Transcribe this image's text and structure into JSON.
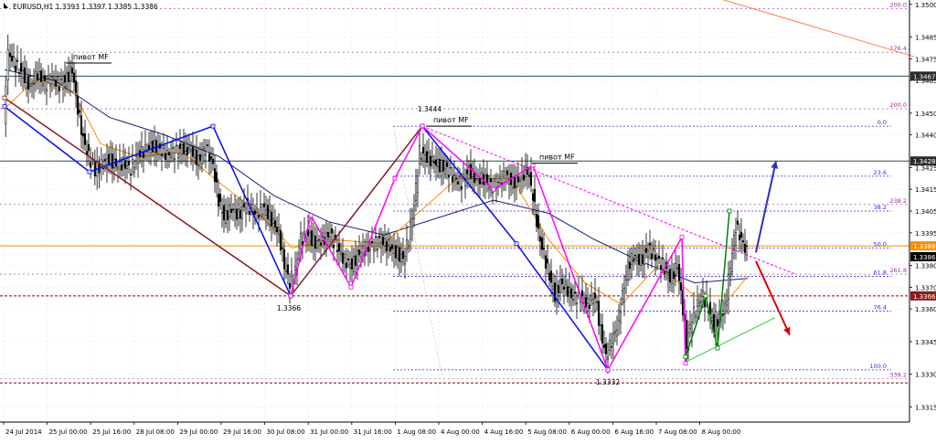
{
  "header": {
    "symbol_text": "EURUSD,H1  1.3393 1.3397 1.3385 1.3386"
  },
  "chart_data": {
    "type": "candlestick",
    "symbol": "EURUSD",
    "timeframe": "H1",
    "ohlc_header": {
      "open": 1.3393,
      "high": 1.3397,
      "low": 1.3385,
      "close": 1.3386
    },
    "ylim": [
      1.3308,
      1.3502
    ],
    "y_ticks": [
      1.35,
      1.3485,
      1.3475,
      1.3465,
      1.345,
      1.344,
      1.3425,
      1.3415,
      1.3405,
      1.3395,
      1.338,
      1.337,
      1.336,
      1.3345,
      1.333,
      1.3315
    ],
    "x_ticks": [
      "24 Jul 2014",
      "25 Jul 00:00",
      "25 Jul 16:00",
      "28 Jul 08:00",
      "29 Jul 00:00",
      "29 Jul 16:00",
      "30 Jul 08:00",
      "31 Jul 00:00",
      "31 Jul 16:00",
      "1 Aug 08:00",
      "4 Aug 00:00",
      "4 Aug 16:00",
      "5 Aug 08:00",
      "6 Aug 00:00",
      "6 Aug 16:00",
      "7 Aug 08:00",
      "8 Aug 00:00"
    ],
    "axis_badges": [
      {
        "value": "1.3467",
        "bg": "#2b2b2b",
        "fg": "#ffffff"
      },
      {
        "value": "1.3428",
        "bg": "#2b2b2b",
        "fg": "#ffffff"
      },
      {
        "value": "1.3388",
        "bg": "#ff8c00",
        "fg": "#ffffff"
      },
      {
        "value": "1.3386",
        "bg": "#000000",
        "fg": "#ffffff"
      },
      {
        "value": "1.3366",
        "bg": "#8b1a1a",
        "fg": "#ffffff"
      }
    ],
    "horizontal_lines": [
      {
        "price": 1.3467,
        "color": "#2f4f4f",
        "style": "solid"
      },
      {
        "price": 1.3428,
        "color": "#2f4f4f",
        "style": "solid"
      },
      {
        "price": 1.3389,
        "color": "#ff8c00",
        "style": "solid"
      },
      {
        "price": 1.3366,
        "color": "#8b0000",
        "style": "dashed"
      },
      {
        "price": 1.3326,
        "color": "#8b0000",
        "style": "dashed"
      }
    ],
    "fibo_levels": [
      {
        "label": "0.0",
        "price": 1.3444
      },
      {
        "label": "23.6",
        "price": 1.3421
      },
      {
        "label": "38.2",
        "price": 1.3405
      },
      {
        "label": "50.0",
        "price": 1.3388
      },
      {
        "label": "61.8",
        "price": 1.3375
      },
      {
        "label": "76.4",
        "price": 1.3359
      },
      {
        "label": "100.0",
        "price": 1.3332
      }
    ],
    "fibo_ext_levels": [
      {
        "label": "200.0",
        "price": 1.3498
      },
      {
        "label": "176.4",
        "price": 1.3478
      },
      {
        "label": "200.0",
        "price": 1.3452
      },
      {
        "label": "238.2",
        "price": 1.3408
      },
      {
        "label": "261.8",
        "price": 1.3376
      },
      {
        "label": "338.2",
        "price": 1.3328
      }
    ],
    "annotations": [
      {
        "text": "пивот MF",
        "x": 80,
        "price": 1.3473
      },
      {
        "text": "пивот MF",
        "x": 474,
        "price": 1.3444
      },
      {
        "text": "пивот MF",
        "x": 590,
        "price": 1.3427
      }
    ],
    "price_labels": [
      {
        "text": "1.3444",
        "x": 470,
        "price": 1.3444
      },
      {
        "text": "1.3366",
        "x": 316,
        "price": 1.3366
      },
      {
        "text": "1.3332",
        "x": 665,
        "price": 1.3332
      }
    ],
    "zigzag": [
      {
        "x": 5,
        "price": 1.3453
      },
      {
        "x": 98,
        "price": 1.3423
      },
      {
        "x": 233,
        "price": 1.3444
      },
      {
        "x": 318,
        "price": 1.3366
      },
      {
        "x": 462,
        "price": 1.3444
      },
      {
        "x": 565,
        "price": 1.339
      },
      {
        "x": 665,
        "price": 1.3332
      }
    ],
    "close_path": [
      {
        "x": 5,
        "price": 1.3448
      },
      {
        "x": 10,
        "price": 1.3478
      },
      {
        "x": 18,
        "price": 1.3472
      },
      {
        "x": 26,
        "price": 1.3468
      },
      {
        "x": 34,
        "price": 1.3462
      },
      {
        "x": 42,
        "price": 1.3468
      },
      {
        "x": 50,
        "price": 1.3463
      },
      {
        "x": 58,
        "price": 1.3466
      },
      {
        "x": 66,
        "price": 1.3463
      },
      {
        "x": 74,
        "price": 1.3466
      },
      {
        "x": 80,
        "price": 1.347
      },
      {
        "x": 86,
        "price": 1.3452
      },
      {
        "x": 92,
        "price": 1.3438
      },
      {
        "x": 98,
        "price": 1.343
      },
      {
        "x": 105,
        "price": 1.3424
      },
      {
        "x": 112,
        "price": 1.3426
      },
      {
        "x": 120,
        "price": 1.3429
      },
      {
        "x": 128,
        "price": 1.3426
      },
      {
        "x": 136,
        "price": 1.3427
      },
      {
        "x": 144,
        "price": 1.3424
      },
      {
        "x": 152,
        "price": 1.3431
      },
      {
        "x": 160,
        "price": 1.3433
      },
      {
        "x": 168,
        "price": 1.3435
      },
      {
        "x": 176,
        "price": 1.3433
      },
      {
        "x": 184,
        "price": 1.3431
      },
      {
        "x": 192,
        "price": 1.3432
      },
      {
        "x": 200,
        "price": 1.3434
      },
      {
        "x": 210,
        "price": 1.3433
      },
      {
        "x": 218,
        "price": 1.3428
      },
      {
        "x": 226,
        "price": 1.3434
      },
      {
        "x": 234,
        "price": 1.3426
      },
      {
        "x": 240,
        "price": 1.341
      },
      {
        "x": 246,
        "price": 1.3402
      },
      {
        "x": 254,
        "price": 1.3406
      },
      {
        "x": 262,
        "price": 1.3403
      },
      {
        "x": 270,
        "price": 1.3408
      },
      {
        "x": 280,
        "price": 1.3404
      },
      {
        "x": 290,
        "price": 1.3406
      },
      {
        "x": 298,
        "price": 1.3401
      },
      {
        "x": 306,
        "price": 1.3395
      },
      {
        "x": 312,
        "price": 1.338
      },
      {
        "x": 318,
        "price": 1.3372
      },
      {
        "x": 324,
        "price": 1.3378
      },
      {
        "x": 330,
        "price": 1.3392
      },
      {
        "x": 338,
        "price": 1.3394
      },
      {
        "x": 346,
        "price": 1.339
      },
      {
        "x": 354,
        "price": 1.3392
      },
      {
        "x": 362,
        "price": 1.3394
      },
      {
        "x": 370,
        "price": 1.3388
      },
      {
        "x": 378,
        "price": 1.3382
      },
      {
        "x": 386,
        "price": 1.338
      },
      {
        "x": 394,
        "price": 1.3386
      },
      {
        "x": 402,
        "price": 1.3388
      },
      {
        "x": 410,
        "price": 1.339
      },
      {
        "x": 418,
        "price": 1.3391
      },
      {
        "x": 426,
        "price": 1.3389
      },
      {
        "x": 434,
        "price": 1.3386
      },
      {
        "x": 442,
        "price": 1.3383
      },
      {
        "x": 448,
        "price": 1.3392
      },
      {
        "x": 454,
        "price": 1.3408
      },
      {
        "x": 460,
        "price": 1.3432
      },
      {
        "x": 466,
        "price": 1.343
      },
      {
        "x": 474,
        "price": 1.3428
      },
      {
        "x": 482,
        "price": 1.3426
      },
      {
        "x": 490,
        "price": 1.3424
      },
      {
        "x": 498,
        "price": 1.342
      },
      {
        "x": 506,
        "price": 1.3418
      },
      {
        "x": 514,
        "price": 1.3424
      },
      {
        "x": 522,
        "price": 1.3419
      },
      {
        "x": 530,
        "price": 1.342
      },
      {
        "x": 538,
        "price": 1.3416
      },
      {
        "x": 546,
        "price": 1.3418
      },
      {
        "x": 554,
        "price": 1.3421
      },
      {
        "x": 562,
        "price": 1.3418
      },
      {
        "x": 570,
        "price": 1.342
      },
      {
        "x": 578,
        "price": 1.3424
      },
      {
        "x": 584,
        "price": 1.3412
      },
      {
        "x": 590,
        "price": 1.3395
      },
      {
        "x": 596,
        "price": 1.3385
      },
      {
        "x": 602,
        "price": 1.3375
      },
      {
        "x": 608,
        "price": 1.3366
      },
      {
        "x": 614,
        "price": 1.3372
      },
      {
        "x": 620,
        "price": 1.337
      },
      {
        "x": 628,
        "price": 1.3365
      },
      {
        "x": 636,
        "price": 1.3366
      },
      {
        "x": 644,
        "price": 1.3362
      },
      {
        "x": 652,
        "price": 1.3366
      },
      {
        "x": 658,
        "price": 1.335
      },
      {
        "x": 664,
        "price": 1.3338
      },
      {
        "x": 670,
        "price": 1.3345
      },
      {
        "x": 676,
        "price": 1.3352
      },
      {
        "x": 682,
        "price": 1.3366
      },
      {
        "x": 688,
        "price": 1.338
      },
      {
        "x": 694,
        "price": 1.3384
      },
      {
        "x": 702,
        "price": 1.3382
      },
      {
        "x": 710,
        "price": 1.3388
      },
      {
        "x": 718,
        "price": 1.3384
      },
      {
        "x": 726,
        "price": 1.338
      },
      {
        "x": 734,
        "price": 1.3374
      },
      {
        "x": 742,
        "price": 1.338
      },
      {
        "x": 748,
        "price": 1.336
      },
      {
        "x": 752,
        "price": 1.3344
      },
      {
        "x": 758,
        "price": 1.3356
      },
      {
        "x": 764,
        "price": 1.3362
      },
      {
        "x": 770,
        "price": 1.3366
      },
      {
        "x": 776,
        "price": 1.336
      },
      {
        "x": 782,
        "price": 1.3352
      },
      {
        "x": 788,
        "price": 1.3356
      },
      {
        "x": 794,
        "price": 1.336
      },
      {
        "x": 800,
        "price": 1.338
      },
      {
        "x": 806,
        "price": 1.3398
      },
      {
        "x": 812,
        "price": 1.3392
      },
      {
        "x": 818,
        "price": 1.3386
      }
    ],
    "ma_fast": [
      {
        "x": 5,
        "price": 1.3452
      },
      {
        "x": 40,
        "price": 1.3466
      },
      {
        "x": 80,
        "price": 1.346
      },
      {
        "x": 110,
        "price": 1.3436
      },
      {
        "x": 150,
        "price": 1.343
      },
      {
        "x": 200,
        "price": 1.3432
      },
      {
        "x": 240,
        "price": 1.3418
      },
      {
        "x": 280,
        "price": 1.3405
      },
      {
        "x": 320,
        "price": 1.3388
      },
      {
        "x": 360,
        "price": 1.3392
      },
      {
        "x": 420,
        "price": 1.339
      },
      {
        "x": 460,
        "price": 1.3405
      },
      {
        "x": 500,
        "price": 1.342
      },
      {
        "x": 560,
        "price": 1.342
      },
      {
        "x": 600,
        "price": 1.3392
      },
      {
        "x": 640,
        "price": 1.3372
      },
      {
        "x": 680,
        "price": 1.3362
      },
      {
        "x": 720,
        "price": 1.338
      },
      {
        "x": 760,
        "price": 1.3366
      },
      {
        "x": 800,
        "price": 1.3366
      },
      {
        "x": 818,
        "price": 1.3375
      }
    ],
    "ma_slow": [
      {
        "x": 5,
        "price": 1.347
      },
      {
        "x": 60,
        "price": 1.3465
      },
      {
        "x": 120,
        "price": 1.3448
      },
      {
        "x": 180,
        "price": 1.344
      },
      {
        "x": 240,
        "price": 1.343
      },
      {
        "x": 300,
        "price": 1.3412
      },
      {
        "x": 360,
        "price": 1.34
      },
      {
        "x": 420,
        "price": 1.3394
      },
      {
        "x": 480,
        "price": 1.3402
      },
      {
        "x": 540,
        "price": 1.341
      },
      {
        "x": 600,
        "price": 1.3404
      },
      {
        "x": 650,
        "price": 1.3392
      },
      {
        "x": 700,
        "price": 1.3382
      },
      {
        "x": 760,
        "price": 1.3372
      },
      {
        "x": 818,
        "price": 1.3374
      }
    ],
    "patterns": [
      {
        "color": "#0000ff",
        "points": [
          {
            "x": 5,
            "price": 1.3453
          },
          {
            "x": 98,
            "price": 1.3423
          },
          {
            "x": 233,
            "price": 1.3444
          },
          {
            "x": 318,
            "price": 1.3366
          }
        ]
      },
      {
        "color": "#8b1a1a",
        "points": [
          {
            "x": 5,
            "price": 1.3457
          },
          {
            "x": 318,
            "price": 1.3366
          },
          {
            "x": 462,
            "price": 1.3444
          }
        ]
      },
      {
        "color": "#ff00ff",
        "points": [
          {
            "x": 318,
            "price": 1.3366
          },
          {
            "x": 340,
            "price": 1.3403
          },
          {
            "x": 384,
            "price": 1.337
          },
          {
            "x": 432,
            "price": 1.342
          },
          {
            "x": 462,
            "price": 1.3444
          }
        ]
      },
      {
        "color": "#0000ff",
        "points": [
          {
            "x": 462,
            "price": 1.3444
          },
          {
            "x": 565,
            "price": 1.339
          },
          {
            "x": 665,
            "price": 1.3332
          }
        ]
      },
      {
        "color": "#ff00ff",
        "points": [
          {
            "x": 462,
            "price": 1.3444
          },
          {
            "x": 540,
            "price": 1.3415
          },
          {
            "x": 583,
            "price": 1.3426
          },
          {
            "x": 665,
            "price": 1.3332
          },
          {
            "x": 746,
            "price": 1.3393
          },
          {
            "x": 750,
            "price": 1.3335
          }
        ]
      },
      {
        "color": "#008000",
        "points": [
          {
            "x": 750,
            "price": 1.3338
          },
          {
            "x": 772,
            "price": 1.3366
          },
          {
            "x": 785,
            "price": 1.3342
          },
          {
            "x": 798,
            "price": 1.3405
          }
        ]
      }
    ],
    "arrows": [
      {
        "color": "#3030c0",
        "from": {
          "x": 827,
          "price": 1.3386
        },
        "to": {
          "x": 849,
          "price": 1.3428
        }
      },
      {
        "color": "#e00000",
        "from": {
          "x": 827,
          "price": 1.3382
        },
        "to": {
          "x": 864,
          "price": 1.3348
        }
      }
    ],
    "trendlines": [
      {
        "color": "#ff7f50",
        "from": {
          "x": 760,
          "price": 1.3506
        },
        "to": {
          "x": 1000,
          "price": 1.3476
        }
      },
      {
        "color": "#ff00ff",
        "dashed": true,
        "from": {
          "x": 462,
          "price": 1.3444
        },
        "to": {
          "x": 870,
          "price": 1.3376
        }
      },
      {
        "color": "#32cd32",
        "from": {
          "x": 752,
          "price": 1.3336
        },
        "to": {
          "x": 848,
          "price": 1.3356
        }
      }
    ]
  }
}
